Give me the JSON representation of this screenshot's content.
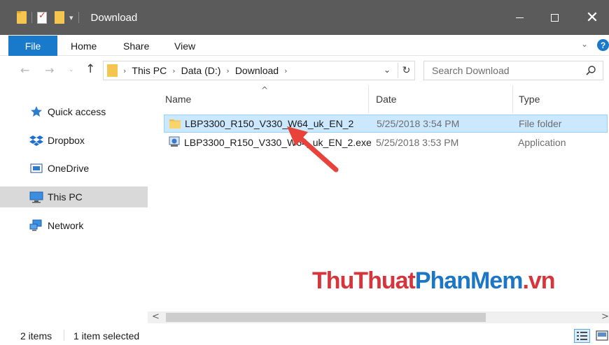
{
  "window": {
    "title": "Download",
    "minimize_icon": "minimize-icon",
    "maximize_icon": "maximize-icon",
    "close_glyph": "✕"
  },
  "ribbon": {
    "tabs": [
      {
        "label": "File"
      },
      {
        "label": "Home"
      },
      {
        "label": "Share"
      },
      {
        "label": "View"
      }
    ],
    "expand_glyph": "⌄",
    "help_glyph": "?"
  },
  "navigation": {
    "back_glyph": "←",
    "forward_glyph": "→",
    "recent_glyph": "⌄",
    "up_glyph": "↑"
  },
  "address": {
    "breadcrumb": [
      "This PC",
      "Data (D:)",
      "Download"
    ],
    "separator": "›",
    "dropdown_glyph": "⌄",
    "refresh_glyph": "↻"
  },
  "search": {
    "placeholder": "Search Download"
  },
  "sidebar": {
    "items": [
      {
        "label": "Quick access",
        "icon": "star-icon"
      },
      {
        "label": "Dropbox",
        "icon": "dropbox-icon"
      },
      {
        "label": "OneDrive",
        "icon": "onedrive-icon"
      },
      {
        "label": "This PC",
        "icon": "computer-icon",
        "selected": true
      },
      {
        "label": "Network",
        "icon": "network-icon"
      }
    ]
  },
  "file_list": {
    "columns": [
      "Name",
      "Date",
      "Type"
    ],
    "sort_glyph": "^",
    "rows": [
      {
        "name": "LBP3300_R150_V330_W64_uk_EN_2",
        "date": "5/25/2018 3:54 PM",
        "type": "File folder",
        "icon": "folder-icon",
        "selected": true
      },
      {
        "name": "LBP3300_R150_V330_W64_uk_EN_2.exe",
        "date": "5/25/2018 3:53 PM",
        "type": "Application",
        "icon": "installer-icon",
        "selected": false
      }
    ]
  },
  "watermark": {
    "part1": "ThuThuat",
    "part2": "PhanMem",
    "part3": ".vn",
    "color_red": "#d6353c",
    "color_blue": "#1b76c6"
  },
  "scrollbar": {
    "left_glyph": "<",
    "right_glyph": ">"
  },
  "status": {
    "item_count": "2 items",
    "selection": "1 item selected"
  },
  "colors": {
    "accent": "#1979ca",
    "titlebar": "#5b5b5b",
    "selection": "#cce8ff",
    "annotation_arrow": "#e8423a"
  }
}
